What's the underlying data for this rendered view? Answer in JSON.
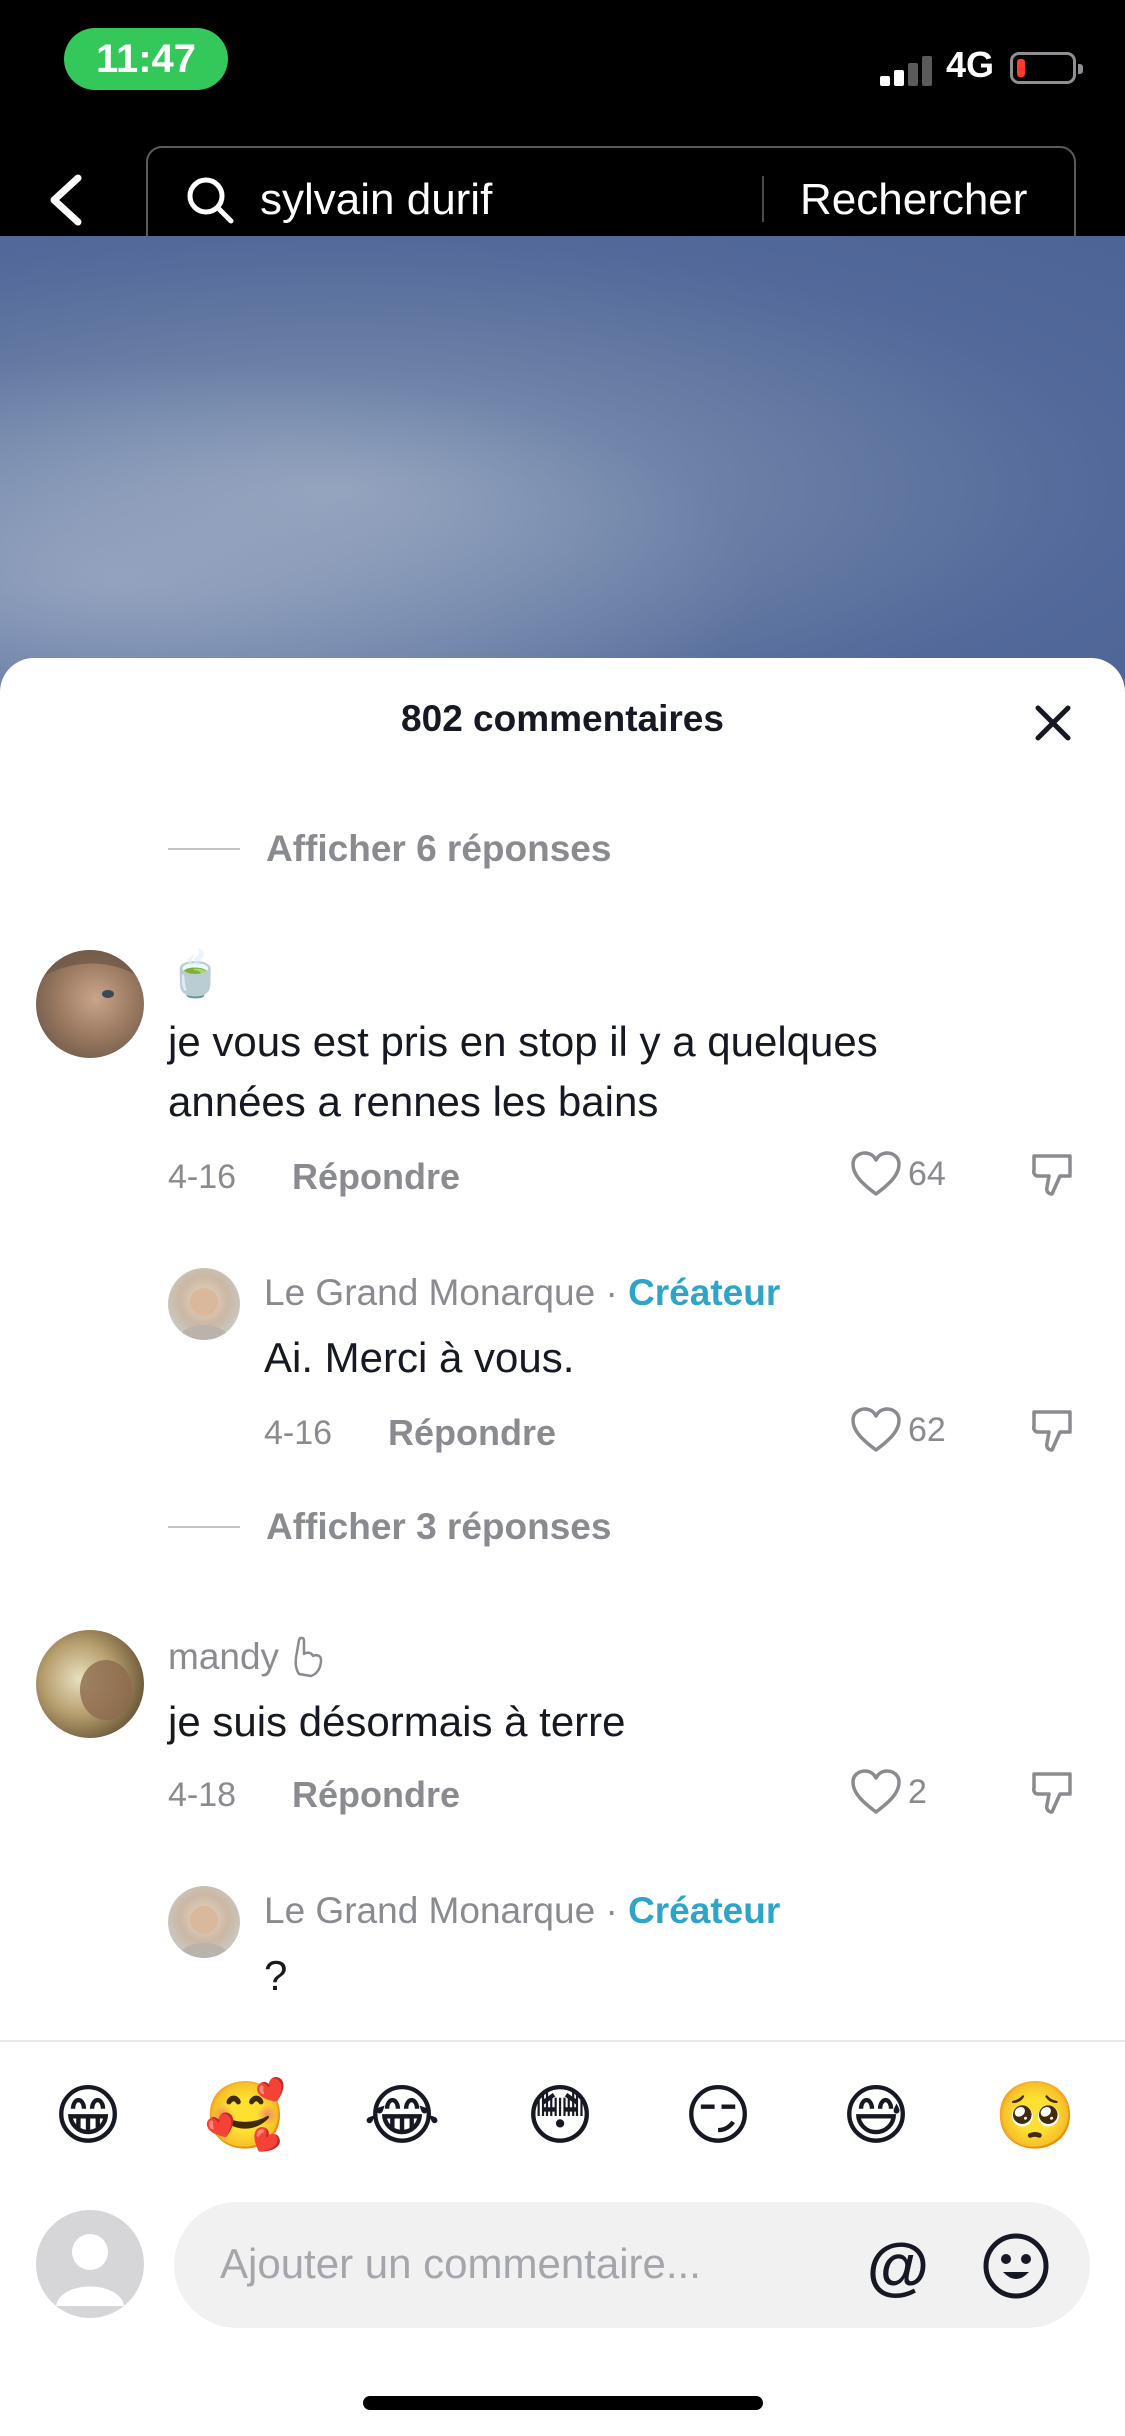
{
  "status_bar": {
    "time": "11:47",
    "network": "4G",
    "battery_color": "#ff3b30"
  },
  "search": {
    "query": "sylvain durif",
    "submit_label": "Rechercher"
  },
  "comments_panel": {
    "title": "802 commentaires",
    "view_replies_1": "Afficher 6 réponses",
    "view_replies_2": "Afficher 3 réponses",
    "comments": [
      {
        "username": "",
        "badge_emoji": "🍵",
        "text_line1": "je vous est pris en stop il y a quelques",
        "text_line2": "années a rennes les bains",
        "date": "4-16",
        "reply_label": "Répondre",
        "likes": "64"
      },
      {
        "username": "mandy",
        "text": "je suis désormais à terre",
        "date": "4-18",
        "reply_label": "Répondre",
        "likes": "2"
      }
    ],
    "replies": [
      {
        "username": "Le Grand Monarque",
        "separator": "·",
        "role": "Créateur",
        "text": "Ai. Merci à vous.",
        "date": "4-16",
        "reply_label": "Répondre",
        "likes": "62"
      },
      {
        "username": "Le Grand Monarque",
        "separator": "·",
        "role": "Créateur",
        "text": "?"
      }
    ]
  },
  "emoji_bar": [
    "😁",
    "🥰",
    "😂",
    "😳",
    "😏",
    "😅",
    "🥺"
  ],
  "composer": {
    "placeholder": "Ajouter un commentaire...",
    "mention_symbol": "@"
  },
  "colors": {
    "accent_creator": "#2ea4c9",
    "status_pill": "#34c759"
  }
}
